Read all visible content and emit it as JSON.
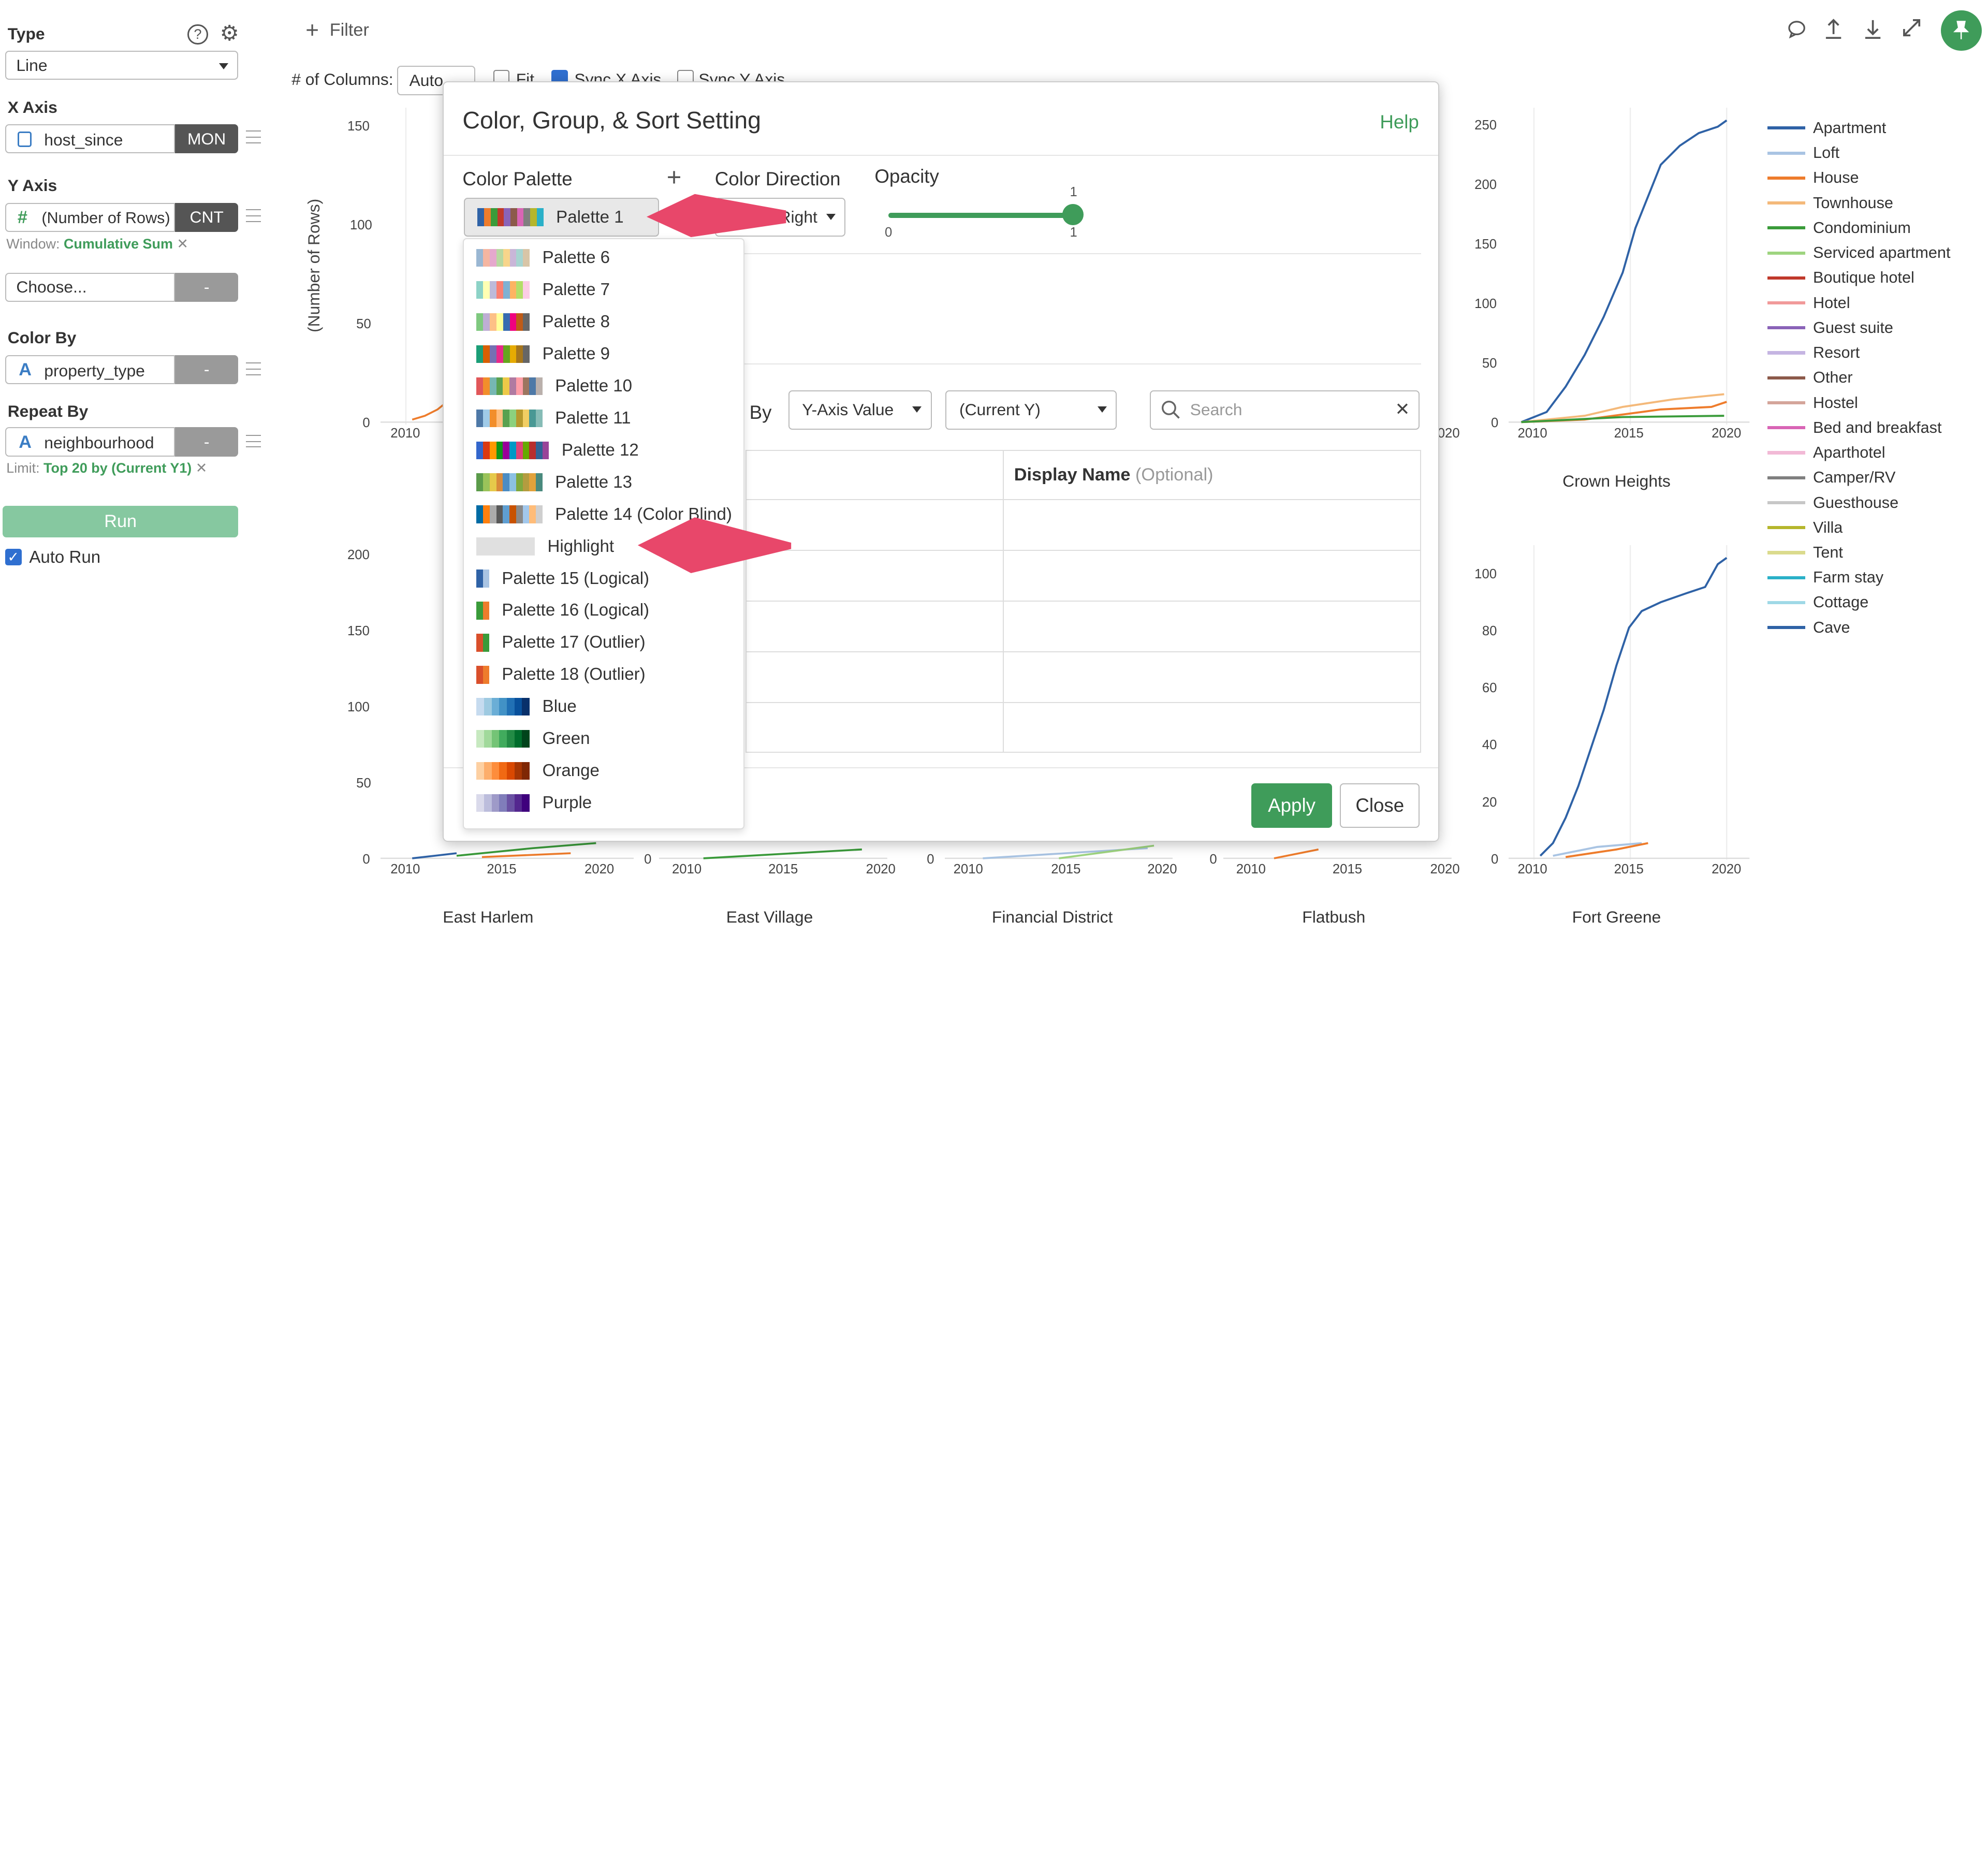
{
  "sidebar": {
    "type_label": "Type",
    "type_value": "Line",
    "x_axis_label": "X Axis",
    "x_field": "host_since",
    "x_agg": "MON",
    "y_axis_label": "Y Axis",
    "y_field": "(Number of Rows)",
    "y_agg": "CNT",
    "window_prefix": "Window:",
    "window_value": "Cumulative Sum",
    "choose_placeholder": "Choose...",
    "choose_agg": "-",
    "color_by_label": "Color By",
    "color_field": "property_type",
    "color_agg": "-",
    "repeat_by_label": "Repeat By",
    "repeat_field": "neighbourhood",
    "repeat_agg": "-",
    "limit_prefix": "Limit:",
    "limit_value": "Top 20 by (Current Y1)",
    "run_label": "Run",
    "auto_run_label": "Auto Run",
    "auto_run_checked": true
  },
  "toolbar": {
    "filter_label": "Filter",
    "columns_label": "# of Columns:",
    "columns_value": "Auto",
    "fit_label": "Fit",
    "sync_x_label": "Sync X Axis",
    "sync_y_label": "Sync Y Axis"
  },
  "charts": {
    "y_axis_title": "(Number of Rows)",
    "top_left_yticks": [
      "150",
      "100",
      "50",
      "0"
    ],
    "top_left_xticks": [
      "2010"
    ],
    "right_top_xtick": "2020",
    "crown_heights": {
      "title": "Crown Heights",
      "yticks": [
        "250",
        "200",
        "150",
        "100",
        "50",
        "0"
      ],
      "xticks": [
        "2010",
        "2015",
        "2020"
      ]
    },
    "fort_greene": {
      "title": "Fort Greene",
      "yticks": [
        "100",
        "80",
        "60",
        "40",
        "20",
        "0"
      ],
      "xticks": [
        "2010",
        "2015",
        "2020"
      ]
    },
    "east_harlem": {
      "title": "East Harlem",
      "yticks": [
        "200",
        "150",
        "100",
        "50",
        "0"
      ],
      "xticks": [
        "2010",
        "2015",
        "2020"
      ]
    },
    "east_village": {
      "title": "East Village",
      "xticks": [
        "0",
        "2010",
        "2015",
        "2020"
      ]
    },
    "financial_district": {
      "title": "Financial District",
      "xticks": [
        "0",
        "2010",
        "2015",
        "2020"
      ]
    },
    "flatbush": {
      "title": "Flatbush",
      "xticks": [
        "0",
        "2010",
        "2015",
        "2020"
      ]
    }
  },
  "legend": [
    {
      "label": "Apartment",
      "color": "#2f62a6"
    },
    {
      "label": "Loft",
      "color": "#a9c4e3"
    },
    {
      "label": "House",
      "color": "#ee7c2c"
    },
    {
      "label": "Townhouse",
      "color": "#f4b97a"
    },
    {
      "label": "Condominium",
      "color": "#3a9b3a"
    },
    {
      "label": "Serviced apartment",
      "color": "#9ed47f"
    },
    {
      "label": "Boutique hotel",
      "color": "#c0392b"
    },
    {
      "label": "Hotel",
      "color": "#f19a9a"
    },
    {
      "label": "Guest suite",
      "color": "#8a63b8"
    },
    {
      "label": "Resort",
      "color": "#c5b5e2"
    },
    {
      "label": "Other",
      "color": "#8c5a4a"
    },
    {
      "label": "Hostel",
      "color": "#d4a59a"
    },
    {
      "label": "Bed and breakfast",
      "color": "#d965b5"
    },
    {
      "label": "Aparthotel",
      "color": "#f2b9d6"
    },
    {
      "label": "Camper/RV",
      "color": "#7f7f7f"
    },
    {
      "label": "Guesthouse",
      "color": "#c7c7c7"
    },
    {
      "label": "Villa",
      "color": "#b5b62c"
    },
    {
      "label": "Tent",
      "color": "#dbdb8d"
    },
    {
      "label": "Farm stay",
      "color": "#2ab0c8"
    },
    {
      "label": "Cottage",
      "color": "#9fd9e6"
    },
    {
      "label": "Cave",
      "color": "#2f62a6"
    }
  ],
  "modal": {
    "title": "Color, Group, & Sort Setting",
    "help": "Help",
    "color_palette_label": "Color Palette",
    "selected_palette": "Palette 1",
    "color_direction_label": "Color Direction",
    "color_direction_value": "Left to Right",
    "opacity_label": "Opacity",
    "opacity_min": "0",
    "opacity_max": "1",
    "opacity_value": "1",
    "sort_by_partial": "rt By",
    "sort_by_value": "Y-Axis Value",
    "sort_target_value": "(Current Y)",
    "search_placeholder": "Search",
    "display_name_header": "Display Name",
    "display_name_optional": "(Optional)",
    "apply_label": "Apply",
    "close_label": "Close"
  },
  "palette_list": [
    {
      "label": "Palette 6",
      "colors": [
        "#9ab7d3",
        "#f5b6a1",
        "#e5a8cd",
        "#b8d8a1",
        "#f7d58b",
        "#c9b6d8",
        "#a7d4d0",
        "#d8c5a7"
      ]
    },
    {
      "label": "Palette 7",
      "colors": [
        "#8dd3c7",
        "#ffffb3",
        "#bebada",
        "#fb8072",
        "#80b1d3",
        "#fdb462",
        "#b3de69",
        "#fccde5"
      ]
    },
    {
      "label": "Palette 8",
      "colors": [
        "#7fc97f",
        "#beaed4",
        "#fdc086",
        "#ffff99",
        "#386cb0",
        "#f0027f",
        "#bf5b17",
        "#666666"
      ]
    },
    {
      "label": "Palette 9",
      "colors": [
        "#1b9e77",
        "#d95f02",
        "#7570b3",
        "#e7298a",
        "#66a61e",
        "#e6ab02",
        "#a6761d",
        "#666666"
      ]
    },
    {
      "label": "Palette 10",
      "colors": [
        "#e15759",
        "#f28e2b",
        "#76b7b2",
        "#59a14f",
        "#edc948",
        "#b07aa1",
        "#ff9da7",
        "#9c755f",
        "#4e79a7",
        "#bab0ac"
      ]
    },
    {
      "label": "Palette 11",
      "colors": [
        "#4e79a7",
        "#a0cbe8",
        "#f28e2b",
        "#ffbe7d",
        "#59a14f",
        "#8cd17d",
        "#b6992d",
        "#f1ce63",
        "#499894",
        "#86bcb6"
      ]
    },
    {
      "label": "Palette 12",
      "colors": [
        "#3366cc",
        "#dc3912",
        "#ff9900",
        "#109618",
        "#990099",
        "#0099c6",
        "#dd4477",
        "#66aa00",
        "#b82e2e",
        "#316395",
        "#994499"
      ]
    },
    {
      "label": "Palette 13",
      "colors": [
        "#5b9b4a",
        "#9ac35a",
        "#e6c94a",
        "#d98a3a",
        "#4c8cc3",
        "#8cc1e3",
        "#7fa93e",
        "#b49c3f",
        "#e2a23b",
        "#4a8a7e"
      ]
    },
    {
      "label": "Palette 14 (Color Blind)",
      "colors": [
        "#006ba4",
        "#ff800e",
        "#ababab",
        "#595959",
        "#5f9ed1",
        "#c85200",
        "#898989",
        "#a2c8ec",
        "#ffbc79",
        "#cfcfcf"
      ]
    },
    {
      "label": "Highlight",
      "colors": [
        "#e0e0e0"
      ]
    },
    {
      "label": "Palette 15 (Logical)",
      "colors": [
        "#2f62a6",
        "#a9c4e3"
      ]
    },
    {
      "label": "Palette 16 (Logical)",
      "colors": [
        "#3a9b3a",
        "#ee7c2c"
      ]
    },
    {
      "label": "Palette 17 (Outlier)",
      "colors": [
        "#d94f2b",
        "#3a9b3a"
      ]
    },
    {
      "label": "Palette 18 (Outlier)",
      "colors": [
        "#d94f2b",
        "#ee7c2c"
      ]
    },
    {
      "label": "Blue",
      "colors": [
        "#c6dbef",
        "#9ecae1",
        "#6baed6",
        "#4292c6",
        "#2171b5",
        "#08519c",
        "#08306b"
      ]
    },
    {
      "label": "Green",
      "colors": [
        "#c7e9c0",
        "#a1d99b",
        "#74c476",
        "#41ab5d",
        "#238b45",
        "#006d2c",
        "#00441b"
      ]
    },
    {
      "label": "Orange",
      "colors": [
        "#fdd0a2",
        "#fdae6b",
        "#fd8d3c",
        "#f16913",
        "#d94801",
        "#a63603",
        "#7f2704"
      ]
    },
    {
      "label": "Purple",
      "colors": [
        "#dadaeb",
        "#bcbddc",
        "#9e9ac8",
        "#807dba",
        "#6a51a3",
        "#54278f",
        "#3f007d"
      ]
    }
  ],
  "selected_palette_colors": [
    "#2f62a6",
    "#ee7c2c",
    "#3a9b3a",
    "#c0392b",
    "#8a63b8",
    "#8c5a4a",
    "#d965b5",
    "#7f7f7f",
    "#b5b62c",
    "#2ab0c8"
  ],
  "colors": {
    "accent": "#3f9c5a",
    "run_button": "#86c8a0",
    "arrow": "#e8476a"
  }
}
